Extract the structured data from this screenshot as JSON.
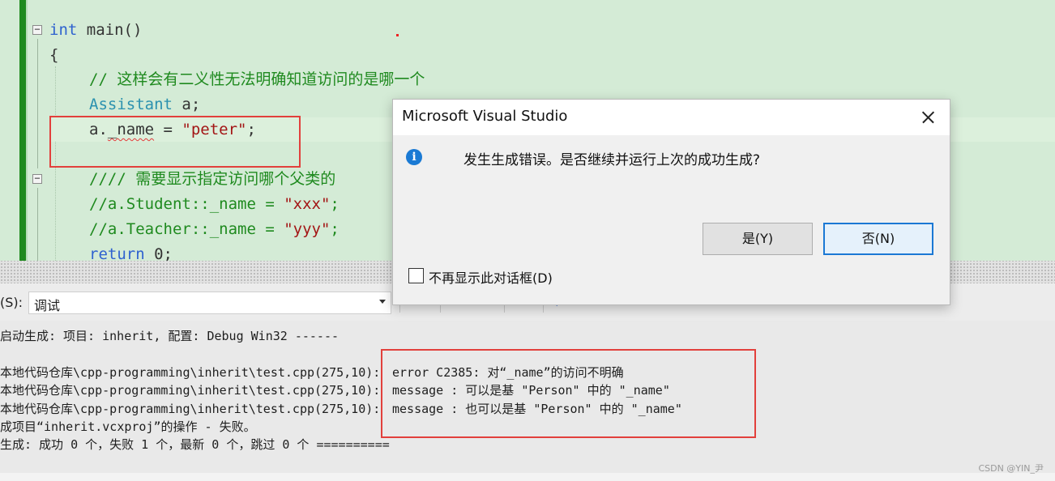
{
  "editor": {
    "code_lines": {
      "line1": {
        "kw": "int",
        "rest": " main()"
      },
      "line2": "{",
      "line3": "// 这样会有二义性无法明确知道访问的是哪一个",
      "line4": {
        "type": "Assistant",
        "rest": " a;"
      },
      "line5": {
        "pre": "a.",
        "member": "_name",
        "mid": " = ",
        "str": "\"peter\"",
        "end": ";"
      },
      "line7": "//// 需要显示指定访问哪个父类的",
      "line8": {
        "pre": "//a.Student::_name = ",
        "str": "\"xxx\"",
        "end": ";"
      },
      "line9": {
        "pre": "//a.Teacher::_name = ",
        "str": "\"yyy\"",
        "end": ";"
      },
      "line10": {
        "kw": "return",
        "rest": " 0;"
      }
    },
    "fold_glyph": "−"
  },
  "toolbar": {
    "source_label": "(S):",
    "source_value": "调试"
  },
  "output": {
    "lines": [
      "启动生成: 项目: inherit, 配置: Debug Win32 ------",
      "",
      "本地代码仓库\\cpp-programming\\inherit\\test.cpp(275,10):",
      "本地代码仓库\\cpp-programming\\inherit\\test.cpp(275,10):",
      "本地代码仓库\\cpp-programming\\inherit\\test.cpp(275,10):",
      "成项目“inherit.vcxproj”的操作 - 失败。",
      "生成: 成功 0 个，失败 1 个，最新 0 个，跳过 0 个 =========="
    ],
    "messages": [
      "error C2385: 对“_name”的访问不明确",
      "message : 可以是基 \"Person\" 中的 \"_name\"",
      "message : 也可以是基 \"Person\" 中的 \"_name\""
    ],
    "watermark": "CSDN @YIN_尹"
  },
  "dialog": {
    "title": "Microsoft Visual Studio",
    "icon": "info-icon",
    "message": "发生生成错误。是否继续并运行上次的成功生成?",
    "yes_label": "是(Y)",
    "no_label": "否(N)",
    "checkbox_label": "不再显示此对话框(D)",
    "checkbox_checked": false
  },
  "colors": {
    "editor_bg": "#d4ebd6",
    "keyword": "#2e62cf",
    "type": "#2b91af",
    "comment": "#1f8a1f",
    "string": "#a31515",
    "highlight_box": "#e2403c",
    "default_button_border": "#1b78d4"
  }
}
